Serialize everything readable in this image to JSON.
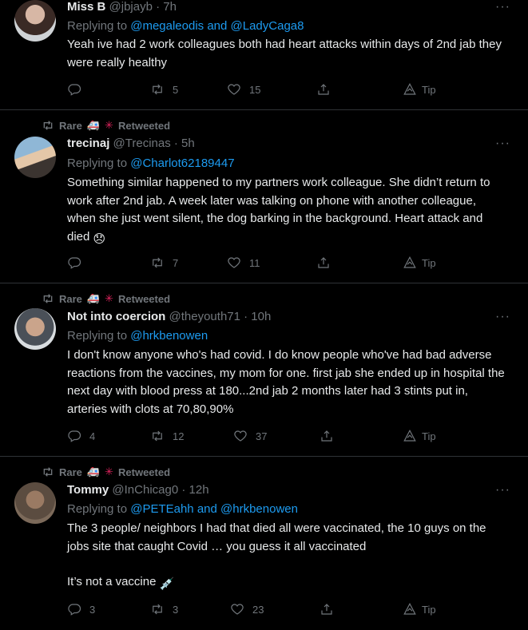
{
  "tweets": [
    {
      "name": "Miss B",
      "handle": "@jbjayb · 7h",
      "replying_prefix": "Replying to ",
      "mentions": "@megaleodis and @LadyCaga8",
      "text": "Yeah ive had 2 work colleagues both had heart attacks within days of 2nd jab they were  really healthy",
      "replies": "",
      "retweets": "5",
      "likes": "15",
      "tip": "Tip"
    },
    {
      "retweeted_by": "Rare",
      "retweeted_label": "Retweeted",
      "name": "trecinaj",
      "handle": "@Trecinas · 5h",
      "replying_prefix": "Replying to ",
      "mentions": "@Charlot62189447",
      "text": "Something similar happened to my partners work colleague. She didn’t return to work after 2nd jab. A week later was talking on phone with another colleague, when she just went silent, the dog barking in the background. Heart attack and died",
      "text_emoji": "😞",
      "replies": "",
      "retweets": "7",
      "likes": "11",
      "tip": "Tip"
    },
    {
      "retweeted_by": "Rare",
      "retweeted_label": "Retweeted",
      "name": "Not into coercion",
      "handle": "@theyouth71 · 10h",
      "replying_prefix": "Replying to ",
      "mentions": "@hrkbenowen",
      "text": "I don't know anyone who's had covid.  I do know people who've had bad adverse reactions from the vaccines, my mom for one. first jab she ended up in hospital the next day with blood press at 180...2nd jab 2 months later had 3 stints put in, arteries with clots at 70,80,90%",
      "replies": "4",
      "retweets": "12",
      "likes": "37",
      "tip": "Tip"
    },
    {
      "retweeted_by": "Rare",
      "retweeted_label": "Retweeted",
      "name": "Tommy",
      "handle": "@InChicag0 · 12h",
      "replying_prefix": "Replying to ",
      "mentions": "@PETEahh and @hrkbenowen",
      "text": "The 3 people/ neighbors I had that died all were vaccinated, the 10 guys on the jobs site that caught Covid … you guess it all vaccinated",
      "text2": "It’s not a vaccine",
      "text2_emoji": "💉",
      "replies": "3",
      "retweets": "3",
      "likes": "23",
      "tip": "Tip"
    }
  ],
  "more_glyph": "···",
  "icons": [
    "reply-icon",
    "retweet-icon",
    "like-icon",
    "share-icon",
    "tip-icon",
    "retweeted-icon",
    "ambulance-emoji",
    "medical-emoji"
  ]
}
